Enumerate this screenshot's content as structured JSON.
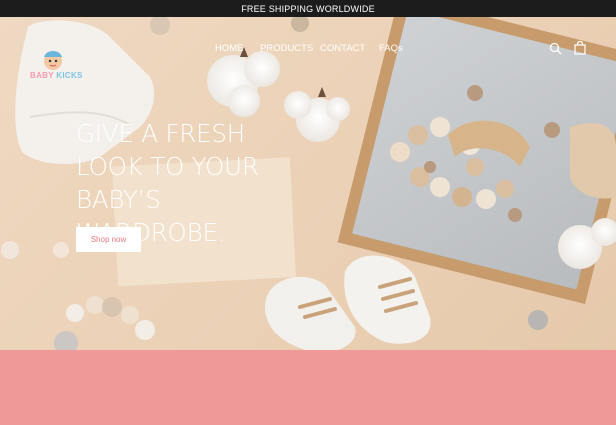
{
  "announcement": {
    "text": "FREE SHIPPING WORLDWIDE"
  },
  "brand": {
    "logo_word1": "BABY",
    "logo_word2": "KICKS"
  },
  "nav": {
    "items": [
      {
        "label": "HOME"
      },
      {
        "label": "PRODUCTS"
      },
      {
        "label": "CONTACT"
      },
      {
        "label": "FAQs"
      }
    ],
    "icons": [
      "search-icon",
      "cart-icon"
    ]
  },
  "hero": {
    "headline": "GIVE A FRESH LOOK TO YOUR BABY’S WARDROBE.",
    "cta_label": "Shop now"
  },
  "colors": {
    "announcement_bg": "#1c1c1c",
    "hero_bg": "#ecd3b9",
    "band": "#ef9a98",
    "cta_text": "#e77a80"
  }
}
